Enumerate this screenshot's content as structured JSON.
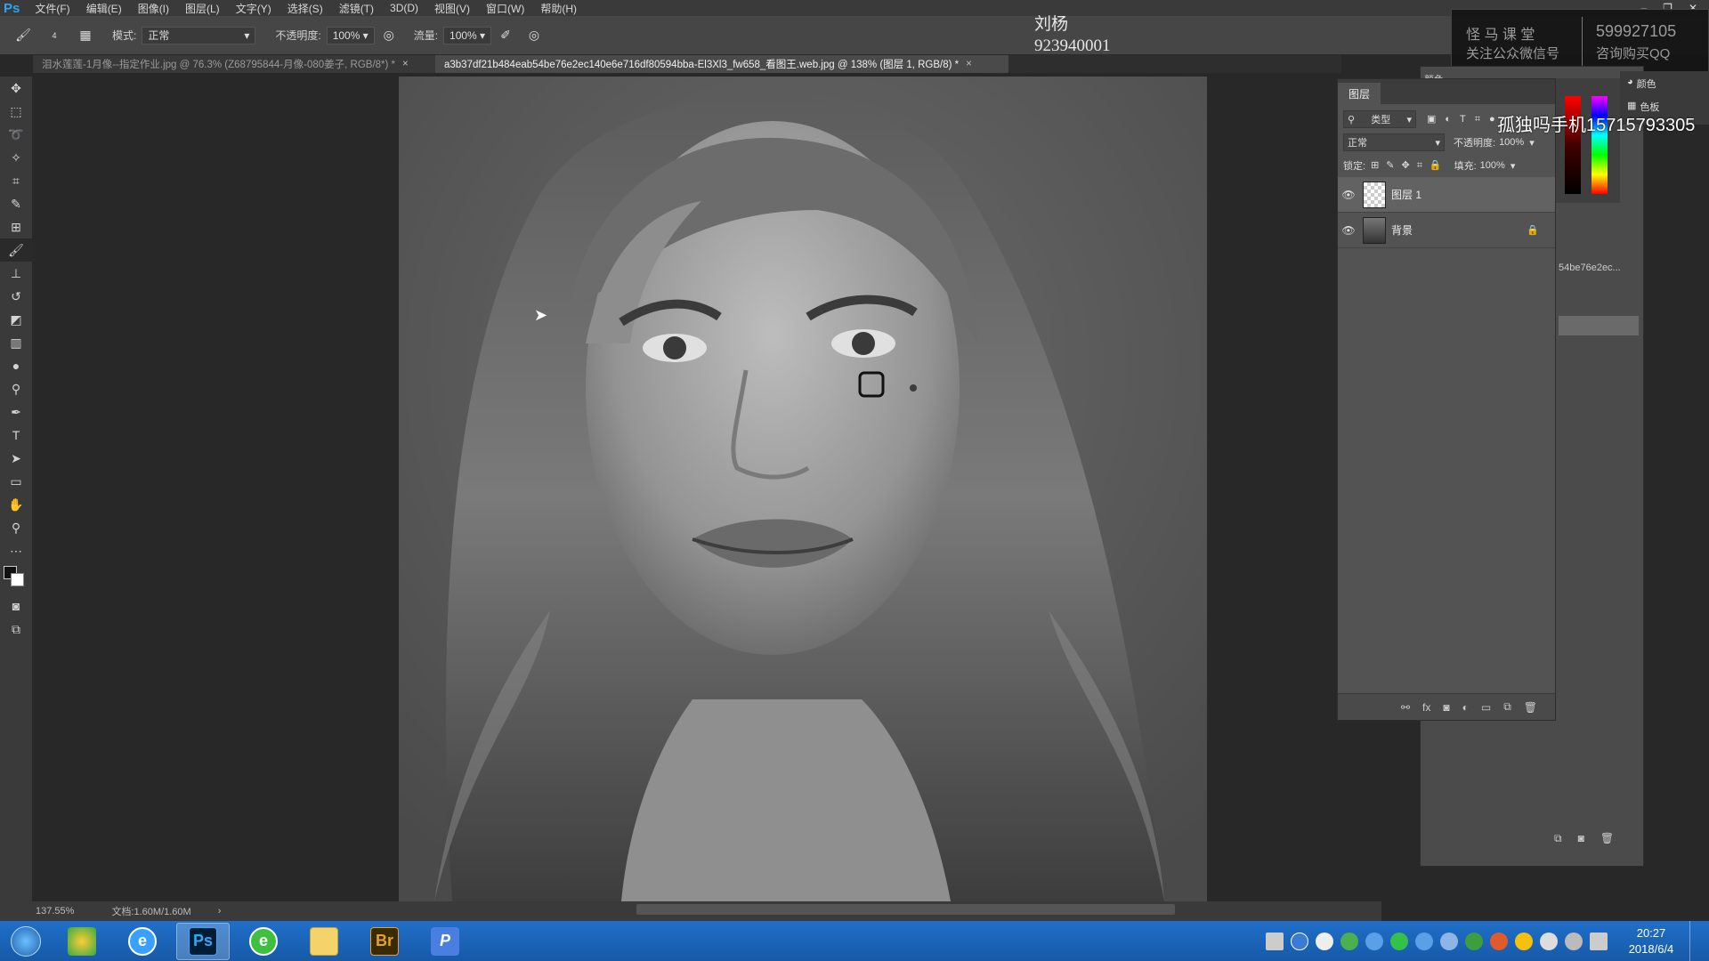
{
  "app": {
    "logo": "Ps"
  },
  "menu": [
    "文件(F)",
    "编辑(E)",
    "图像(I)",
    "图层(L)",
    "文字(Y)",
    "选择(S)",
    "滤镜(T)",
    "3D(D)",
    "视图(V)",
    "窗口(W)",
    "帮助(H)"
  ],
  "options": {
    "mode_label": "模式:",
    "mode_value": "正常",
    "opacity_label": "不透明度:",
    "opacity_value": "100%",
    "flow_label": "流量:",
    "flow_value": "100%",
    "brush_size": "4"
  },
  "tabs": [
    {
      "title": "泪水莲莲-1月像--指定作业.jpg @ 76.3% (Z68795844-月像-080姜子, RGB/8*) *",
      "active": false
    },
    {
      "title": "a3b37df21b484eab54be76e2ec140e6e716df80594bba-El3Xl3_fw658_看图王.web.jpg @ 138% (图层 1, RGB/8) *",
      "active": true
    }
  ],
  "overlay": {
    "name": "刘杨",
    "id": "923940001",
    "wm_line1": "怪  马  课  堂",
    "wm_line2": "关注公众微信号",
    "wm_qq": "599927105",
    "wm_qq2": "咨询购买QQ",
    "phone": "孤独吗手机15715793305"
  },
  "status": {
    "zoom": "137.55%",
    "doc": "文档:1.60M/1.60M"
  },
  "layers_panel": {
    "tab": "图层",
    "filter_label": "类型",
    "blend_mode": "正常",
    "opacity_label": "不透明度:",
    "opacity_value": "100%",
    "lock_label": "锁定:",
    "fill_label": "填充:",
    "fill_value": "100%",
    "layers": [
      {
        "name": "图层 1",
        "selected": true,
        "locked": false
      },
      {
        "name": "背景",
        "selected": false,
        "locked": true
      }
    ]
  },
  "side_panel": {
    "color_tab": "颜色",
    "swatch_tab": "色板",
    "history_tab": "颜色",
    "history_item": "54be76e2ec..."
  },
  "taskbar": {
    "apps": [
      "Ps",
      "Br",
      "P"
    ],
    "time": "20:27",
    "date": "2018/6/4"
  },
  "colors": {
    "menubar": "#3a3a3a",
    "panel": "#535353",
    "taskbar": "#1f6fc9",
    "ps_blue": "#2fa3f6"
  }
}
